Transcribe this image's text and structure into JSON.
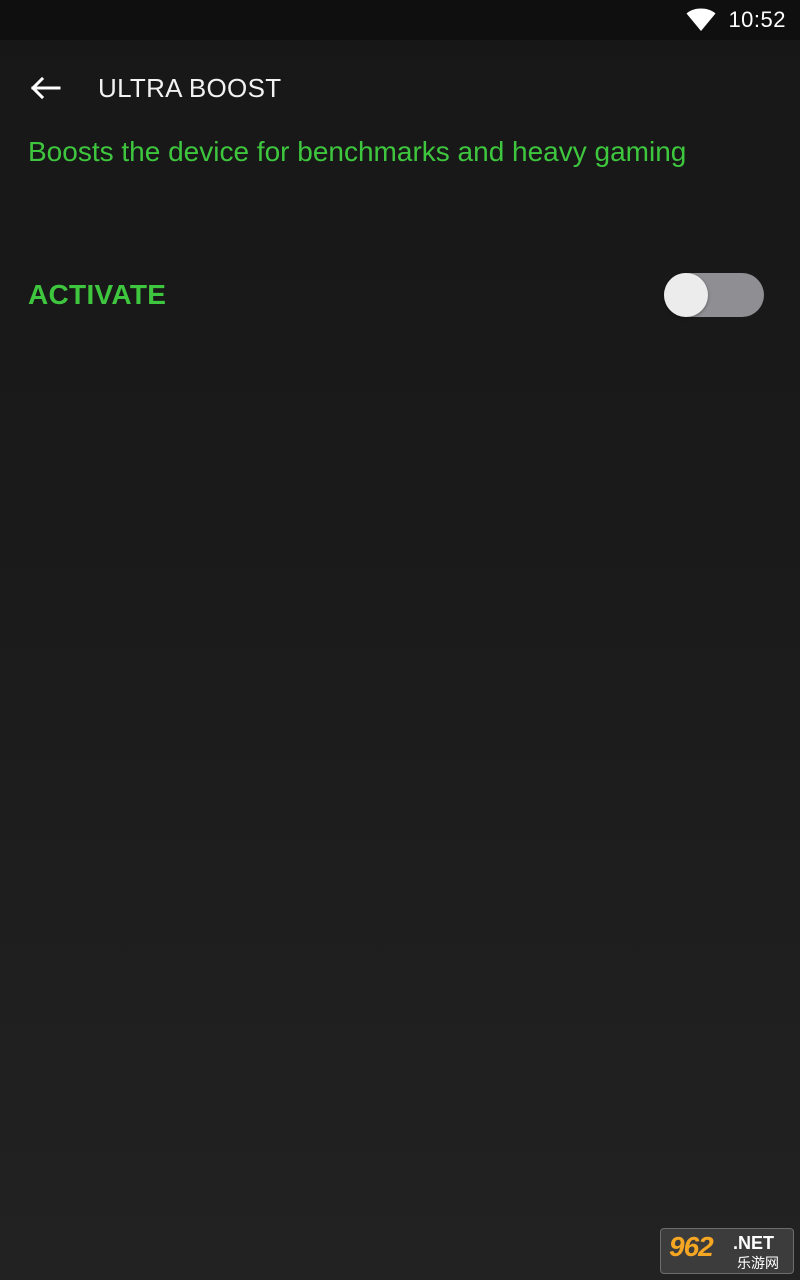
{
  "status_bar": {
    "time": "10:52",
    "icons": [
      "wifi-icon"
    ]
  },
  "toolbar": {
    "back_icon": "back-arrow-icon",
    "title": "ULTRA BOOST"
  },
  "description": "Boosts the device for benchmarks and heavy gaming",
  "activate": {
    "label": "ACTIVATE",
    "toggle_on": false
  },
  "watermark": {
    "number": "962",
    "suffix": ".NET",
    "cn": "乐游网"
  },
  "colors": {
    "accent_green": "#3ec63e",
    "background": "#1b1b1b",
    "toggle_track_off": "#8e8e93",
    "toggle_thumb": "#ececec"
  }
}
